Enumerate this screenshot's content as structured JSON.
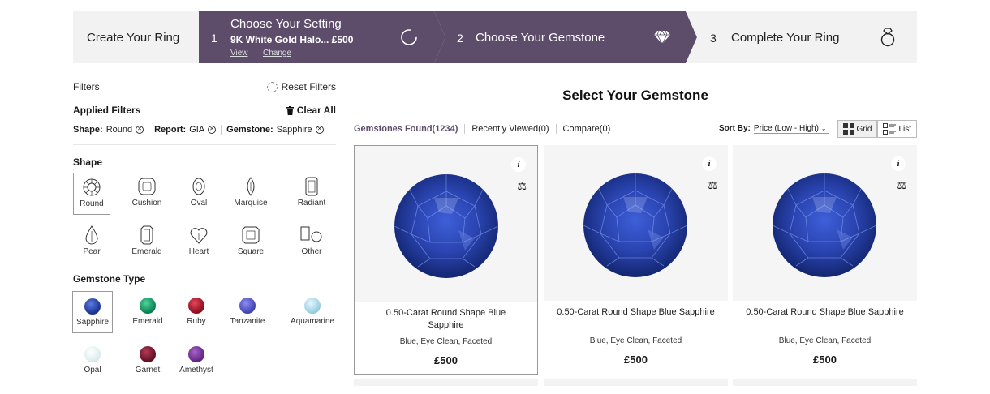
{
  "steps": {
    "create_label": "Create Your Ring",
    "step1": {
      "num": "1",
      "title": "Choose Your Setting",
      "sub": "9K White Gold Halo... £500",
      "view": "View",
      "change": "Change"
    },
    "step2": {
      "num": "2",
      "title": "Choose Your Gemstone"
    },
    "step3": {
      "num": "3",
      "title": "Complete Your Ring"
    }
  },
  "filters": {
    "label": "Filters",
    "reset": "Reset Filters",
    "applied_title": "Applied Filters",
    "clear_all": "Clear All",
    "chips": [
      {
        "key": "Shape:",
        "value": "Round"
      },
      {
        "key": "Report:",
        "value": "GIA"
      },
      {
        "key": "Gemstone:",
        "value": "Sapphire"
      }
    ],
    "shape_title": "Shape",
    "shapes": [
      "Round",
      "Cushion",
      "Oval",
      "Marquise",
      "Radiant",
      "Pear",
      "Emerald",
      "Heart",
      "Square",
      "Other"
    ],
    "selected_shape": "Round",
    "gem_title": "Gemstone Type",
    "gems": [
      {
        "name": "Sapphire",
        "color": "#1f3c9c"
      },
      {
        "name": "Emerald",
        "color": "#0f8a5a"
      },
      {
        "name": "Ruby",
        "color": "#9c1024"
      },
      {
        "name": "Tanzanite",
        "color": "#4a4cb8"
      },
      {
        "name": "Aquamarine",
        "color": "#9fd2e6"
      },
      {
        "name": "Opal",
        "color": "#dfeeee"
      },
      {
        "name": "Garnet",
        "color": "#6a1428"
      },
      {
        "name": "Amethyst",
        "color": "#6b2a8c"
      }
    ],
    "selected_gem": "Sapphire"
  },
  "main": {
    "title": "Select Your Gemstone",
    "tabs": [
      "Gemstones Found(1234)",
      "Recently Viewed(0)",
      "Compare(0)"
    ],
    "sort_label": "Sort By:",
    "sort_value": "Price (Low - High)",
    "view_grid": "Grid",
    "view_list": "List",
    "cards": [
      {
        "title": "0.50-Carat Round Shape Blue Sapphire",
        "desc": "Blue, Eye Clean, Faceted",
        "price": "£500"
      },
      {
        "title": "0.50-Carat Round Shape Blue Sapphire",
        "desc": "Blue, Eye Clean, Faceted",
        "price": "£500"
      },
      {
        "title": "0.50-Carat Round Shape Blue Sapphire",
        "desc": "Blue, Eye Clean, Faceted",
        "price": "£500"
      }
    ]
  },
  "colors": {
    "accent": "#5d4d6b",
    "sapphire": "#2a44b0"
  }
}
